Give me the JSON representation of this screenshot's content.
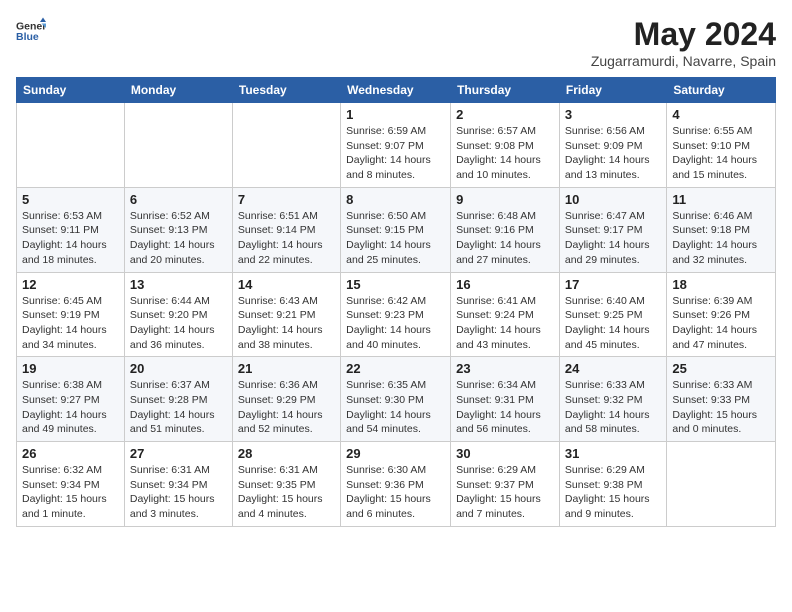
{
  "header": {
    "logo_general": "General",
    "logo_blue": "Blue",
    "month_year": "May 2024",
    "location": "Zugarramurdi, Navarre, Spain"
  },
  "weekdays": [
    "Sunday",
    "Monday",
    "Tuesday",
    "Wednesday",
    "Thursday",
    "Friday",
    "Saturday"
  ],
  "weeks": [
    [
      {
        "day": "",
        "detail": ""
      },
      {
        "day": "",
        "detail": ""
      },
      {
        "day": "",
        "detail": ""
      },
      {
        "day": "1",
        "detail": "Sunrise: 6:59 AM\nSunset: 9:07 PM\nDaylight: 14 hours\nand 8 minutes."
      },
      {
        "day": "2",
        "detail": "Sunrise: 6:57 AM\nSunset: 9:08 PM\nDaylight: 14 hours\nand 10 minutes."
      },
      {
        "day": "3",
        "detail": "Sunrise: 6:56 AM\nSunset: 9:09 PM\nDaylight: 14 hours\nand 13 minutes."
      },
      {
        "day": "4",
        "detail": "Sunrise: 6:55 AM\nSunset: 9:10 PM\nDaylight: 14 hours\nand 15 minutes."
      }
    ],
    [
      {
        "day": "5",
        "detail": "Sunrise: 6:53 AM\nSunset: 9:11 PM\nDaylight: 14 hours\nand 18 minutes."
      },
      {
        "day": "6",
        "detail": "Sunrise: 6:52 AM\nSunset: 9:13 PM\nDaylight: 14 hours\nand 20 minutes."
      },
      {
        "day": "7",
        "detail": "Sunrise: 6:51 AM\nSunset: 9:14 PM\nDaylight: 14 hours\nand 22 minutes."
      },
      {
        "day": "8",
        "detail": "Sunrise: 6:50 AM\nSunset: 9:15 PM\nDaylight: 14 hours\nand 25 minutes."
      },
      {
        "day": "9",
        "detail": "Sunrise: 6:48 AM\nSunset: 9:16 PM\nDaylight: 14 hours\nand 27 minutes."
      },
      {
        "day": "10",
        "detail": "Sunrise: 6:47 AM\nSunset: 9:17 PM\nDaylight: 14 hours\nand 29 minutes."
      },
      {
        "day": "11",
        "detail": "Sunrise: 6:46 AM\nSunset: 9:18 PM\nDaylight: 14 hours\nand 32 minutes."
      }
    ],
    [
      {
        "day": "12",
        "detail": "Sunrise: 6:45 AM\nSunset: 9:19 PM\nDaylight: 14 hours\nand 34 minutes."
      },
      {
        "day": "13",
        "detail": "Sunrise: 6:44 AM\nSunset: 9:20 PM\nDaylight: 14 hours\nand 36 minutes."
      },
      {
        "day": "14",
        "detail": "Sunrise: 6:43 AM\nSunset: 9:21 PM\nDaylight: 14 hours\nand 38 minutes."
      },
      {
        "day": "15",
        "detail": "Sunrise: 6:42 AM\nSunset: 9:23 PM\nDaylight: 14 hours\nand 40 minutes."
      },
      {
        "day": "16",
        "detail": "Sunrise: 6:41 AM\nSunset: 9:24 PM\nDaylight: 14 hours\nand 43 minutes."
      },
      {
        "day": "17",
        "detail": "Sunrise: 6:40 AM\nSunset: 9:25 PM\nDaylight: 14 hours\nand 45 minutes."
      },
      {
        "day": "18",
        "detail": "Sunrise: 6:39 AM\nSunset: 9:26 PM\nDaylight: 14 hours\nand 47 minutes."
      }
    ],
    [
      {
        "day": "19",
        "detail": "Sunrise: 6:38 AM\nSunset: 9:27 PM\nDaylight: 14 hours\nand 49 minutes."
      },
      {
        "day": "20",
        "detail": "Sunrise: 6:37 AM\nSunset: 9:28 PM\nDaylight: 14 hours\nand 51 minutes."
      },
      {
        "day": "21",
        "detail": "Sunrise: 6:36 AM\nSunset: 9:29 PM\nDaylight: 14 hours\nand 52 minutes."
      },
      {
        "day": "22",
        "detail": "Sunrise: 6:35 AM\nSunset: 9:30 PM\nDaylight: 14 hours\nand 54 minutes."
      },
      {
        "day": "23",
        "detail": "Sunrise: 6:34 AM\nSunset: 9:31 PM\nDaylight: 14 hours\nand 56 minutes."
      },
      {
        "day": "24",
        "detail": "Sunrise: 6:33 AM\nSunset: 9:32 PM\nDaylight: 14 hours\nand 58 minutes."
      },
      {
        "day": "25",
        "detail": "Sunrise: 6:33 AM\nSunset: 9:33 PM\nDaylight: 15 hours\nand 0 minutes."
      }
    ],
    [
      {
        "day": "26",
        "detail": "Sunrise: 6:32 AM\nSunset: 9:34 PM\nDaylight: 15 hours\nand 1 minute."
      },
      {
        "day": "27",
        "detail": "Sunrise: 6:31 AM\nSunset: 9:34 PM\nDaylight: 15 hours\nand 3 minutes."
      },
      {
        "day": "28",
        "detail": "Sunrise: 6:31 AM\nSunset: 9:35 PM\nDaylight: 15 hours\nand 4 minutes."
      },
      {
        "day": "29",
        "detail": "Sunrise: 6:30 AM\nSunset: 9:36 PM\nDaylight: 15 hours\nand 6 minutes."
      },
      {
        "day": "30",
        "detail": "Sunrise: 6:29 AM\nSunset: 9:37 PM\nDaylight: 15 hours\nand 7 minutes."
      },
      {
        "day": "31",
        "detail": "Sunrise: 6:29 AM\nSunset: 9:38 PM\nDaylight: 15 hours\nand 9 minutes."
      },
      {
        "day": "",
        "detail": ""
      }
    ]
  ]
}
